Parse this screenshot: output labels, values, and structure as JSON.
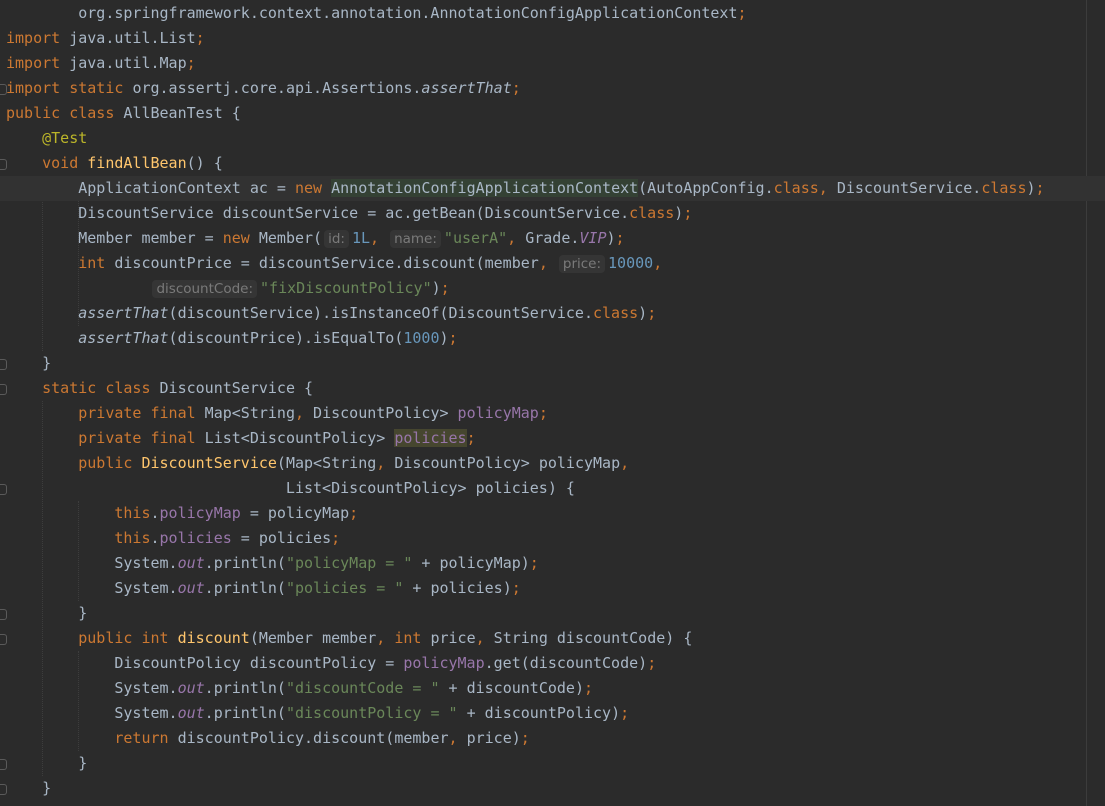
{
  "lines": [
    {
      "indent": 8,
      "tokens": [
        [
          "org.springframework.context.annotation.AnnotationConfigApplicationContext",
          ""
        ],
        [
          ";",
          "k"
        ]
      ]
    },
    {
      "indent": 0,
      "tokens": [
        [
          "import ",
          "k"
        ],
        [
          "java.util.List",
          ""
        ],
        [
          ";",
          "k"
        ]
      ]
    },
    {
      "indent": 0,
      "tokens": [
        [
          "import ",
          "k"
        ],
        [
          "java.util.Map",
          ""
        ],
        [
          ";",
          "k"
        ]
      ]
    },
    {
      "indent": 0,
      "tokens": [
        [
          "import static ",
          "k"
        ],
        [
          "org.assertj.core.api.Assertions.",
          ""
        ],
        [
          "assertThat",
          "i"
        ],
        [
          ";",
          "k"
        ]
      ]
    },
    {
      "indent": 0,
      "tokens": [
        [
          "public class ",
          "k"
        ],
        [
          "AllBeanTest {",
          ""
        ]
      ]
    },
    {
      "indent": 4,
      "tokens": [
        [
          "@Test",
          "a"
        ]
      ]
    },
    {
      "indent": 4,
      "tokens": [
        [
          "void ",
          "k"
        ],
        [
          "findAllBean",
          "m"
        ],
        [
          "() {",
          ""
        ]
      ]
    },
    {
      "indent": 8,
      "caret": true,
      "tokens": [
        [
          "ApplicationContext ac = ",
          ""
        ],
        [
          "new ",
          "k"
        ],
        [
          "AnnotationConfigApplicationContext",
          "hl"
        ],
        [
          "(AutoAppConfig.",
          ""
        ],
        [
          "class",
          "k"
        ],
        [
          ", ",
          "k"
        ],
        [
          "DiscountService.",
          ""
        ],
        [
          "class",
          "k"
        ],
        [
          ")",
          ""
        ],
        [
          ";",
          "k"
        ]
      ]
    },
    {
      "indent": 8,
      "tokens": [
        [
          "DiscountService discountService = ac.getBean(DiscountService.",
          ""
        ],
        [
          "class",
          "k"
        ],
        [
          ")",
          ""
        ],
        [
          ";",
          "k"
        ]
      ]
    },
    {
      "indent": 8,
      "tokens": [
        [
          "Member member = ",
          ""
        ],
        [
          "new ",
          "k"
        ],
        [
          "Member(",
          ""
        ],
        [
          "id:",
          "h"
        ],
        [
          "1L",
          "n"
        ],
        [
          ", ",
          "k"
        ],
        [
          "name:",
          "h"
        ],
        [
          "\"userA\"",
          "s"
        ],
        [
          ", ",
          "k"
        ],
        [
          "Grade.",
          ""
        ],
        [
          "VIP",
          "fi"
        ],
        [
          ")",
          ""
        ],
        [
          ";",
          "k"
        ]
      ]
    },
    {
      "indent": 8,
      "tokens": [
        [
          "int ",
          "k"
        ],
        [
          "discountPrice = discountService.discount(member",
          ""
        ],
        [
          ", ",
          "k"
        ],
        [
          "price:",
          "h"
        ],
        [
          "10000",
          "n"
        ],
        [
          ",",
          "k"
        ]
      ]
    },
    {
      "indent": 16,
      "tokens": [
        [
          "discountCode:",
          "h"
        ],
        [
          "\"fixDiscountPolicy\"",
          "s"
        ],
        [
          ")",
          ""
        ],
        [
          ";",
          "k"
        ]
      ]
    },
    {
      "indent": 8,
      "tokens": [
        [
          "assertThat",
          "i"
        ],
        [
          "(discountService).isInstanceOf(DiscountService.",
          ""
        ],
        [
          "class",
          "k"
        ],
        [
          ")",
          ""
        ],
        [
          ";",
          "k"
        ]
      ]
    },
    {
      "indent": 8,
      "tokens": [
        [
          "assertThat",
          "i"
        ],
        [
          "(discountPrice).isEqualTo(",
          ""
        ],
        [
          "1000",
          "n"
        ],
        [
          ")",
          ""
        ],
        [
          ";",
          "k"
        ]
      ]
    },
    {
      "indent": 4,
      "tokens": [
        [
          "}",
          ""
        ]
      ]
    },
    {
      "indent": 4,
      "tokens": [
        [
          "static class ",
          "k"
        ],
        [
          "DiscountService {",
          ""
        ]
      ]
    },
    {
      "indent": 8,
      "tokens": [
        [
          "private final ",
          "k"
        ],
        [
          "Map<String",
          ""
        ],
        [
          ", ",
          "k"
        ],
        [
          "DiscountPolicy> ",
          ""
        ],
        [
          "policyMap",
          "f"
        ],
        [
          ";",
          "k"
        ]
      ]
    },
    {
      "indent": 8,
      "tokens": [
        [
          "private final ",
          "k"
        ],
        [
          "List<DiscountPolicy> ",
          ""
        ],
        [
          "policies",
          "hl2 f"
        ],
        [
          ";",
          "k"
        ]
      ]
    },
    {
      "indent": 8,
      "tokens": [
        [
          "public ",
          "k"
        ],
        [
          "DiscountService",
          "m"
        ],
        [
          "(Map<String",
          ""
        ],
        [
          ", ",
          "k"
        ],
        [
          "DiscountPolicy> policyMap",
          ""
        ],
        [
          ",",
          "k"
        ]
      ]
    },
    {
      "indent": 31,
      "tokens": [
        [
          "List<DiscountPolicy> policies) {",
          ""
        ]
      ]
    },
    {
      "indent": 12,
      "tokens": [
        [
          "this",
          "k"
        ],
        [
          ".",
          ""
        ],
        [
          "policyMap",
          "f"
        ],
        [
          " = policyMap",
          ""
        ],
        [
          ";",
          "k"
        ]
      ]
    },
    {
      "indent": 12,
      "tokens": [
        [
          "this",
          "k"
        ],
        [
          ".",
          ""
        ],
        [
          "policies",
          "f"
        ],
        [
          " = policies",
          ""
        ],
        [
          ";",
          "k"
        ]
      ]
    },
    {
      "indent": 12,
      "tokens": [
        [
          "System.",
          ""
        ],
        [
          "out",
          "fi"
        ],
        [
          ".println(",
          ""
        ],
        [
          "\"policyMap = \"",
          "s"
        ],
        [
          " + policyMap)",
          ""
        ],
        [
          ";",
          "k"
        ]
      ]
    },
    {
      "indent": 12,
      "tokens": [
        [
          "System.",
          ""
        ],
        [
          "out",
          "fi"
        ],
        [
          ".println(",
          ""
        ],
        [
          "\"policies = \"",
          "s"
        ],
        [
          " + policies)",
          ""
        ],
        [
          ";",
          "k"
        ]
      ]
    },
    {
      "indent": 8,
      "tokens": [
        [
          "}",
          ""
        ]
      ]
    },
    {
      "indent": 8,
      "tokens": [
        [
          "public int ",
          "k"
        ],
        [
          "discount",
          "m"
        ],
        [
          "(Member member",
          ""
        ],
        [
          ", ",
          "k"
        ],
        [
          "int ",
          "k"
        ],
        [
          "price",
          ""
        ],
        [
          ", ",
          "k"
        ],
        [
          "String discountCode) {",
          ""
        ]
      ]
    },
    {
      "indent": 12,
      "tokens": [
        [
          "DiscountPolicy discountPolicy = ",
          ""
        ],
        [
          "policyMap",
          "f"
        ],
        [
          ".get(discountCode)",
          ""
        ],
        [
          ";",
          "k"
        ]
      ]
    },
    {
      "indent": 12,
      "tokens": [
        [
          "System.",
          ""
        ],
        [
          "out",
          "fi"
        ],
        [
          ".println(",
          ""
        ],
        [
          "\"discountCode = \"",
          "s"
        ],
        [
          " + discountCode)",
          ""
        ],
        [
          ";",
          "k"
        ]
      ]
    },
    {
      "indent": 12,
      "tokens": [
        [
          "System.",
          ""
        ],
        [
          "out",
          "fi"
        ],
        [
          ".println(",
          ""
        ],
        [
          "\"discountPolicy = \"",
          "s"
        ],
        [
          " + discountPolicy)",
          ""
        ],
        [
          ";",
          "k"
        ]
      ]
    },
    {
      "indent": 12,
      "tokens": [
        [
          "return ",
          "k"
        ],
        [
          "discountPolicy.discount(member",
          ""
        ],
        [
          ", ",
          "k"
        ],
        [
          "price)",
          ""
        ],
        [
          ";",
          "k"
        ]
      ]
    },
    {
      "indent": 8,
      "tokens": [
        [
          "}",
          ""
        ]
      ]
    },
    {
      "indent": 4,
      "tokens": [
        [
          "}",
          ""
        ]
      ]
    }
  ],
  "colors": {
    "background": "#2b2b2b",
    "text": "#a9b7c6",
    "keyword": "#cc7832",
    "string": "#6a8759",
    "number": "#6897bb",
    "field": "#9876aa",
    "annotation": "#bbb529",
    "method": "#ffc66d"
  }
}
